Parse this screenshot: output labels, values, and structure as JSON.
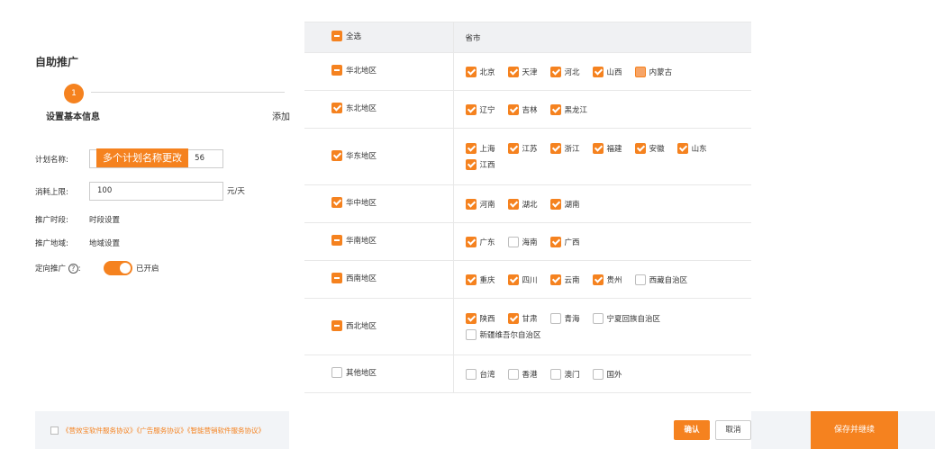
{
  "form": {
    "title": "自助推广",
    "step_number": "1",
    "step1_label": "设置基本信息",
    "step2_label": "添加",
    "plan_name_label": "计划名称:",
    "plan_name_tag": "多个计划名称更改",
    "plan_name_suffix": "56",
    "budget_label": "消耗上限:",
    "budget_value": "100",
    "budget_unit": "元/天",
    "time_label": "推广时段:",
    "time_value": "时段设置",
    "region_label": "推广地域:",
    "region_value": "地域设置",
    "targeting_label": "定向推广",
    "targeting_colon": ":",
    "help_glyph": "?",
    "targeting_state": "已开启"
  },
  "agreement": {
    "text": "《营效宝软件服务协议》《广告服务协议》《智能营销软件服务协议》"
  },
  "save_continue": "保存并继续",
  "table": {
    "select_all": "全选",
    "province_header": "省市",
    "rows": [
      {
        "region": "华北地区",
        "state": "partial",
        "provinces": [
          {
            "name": "北京",
            "state": "checked"
          },
          {
            "name": "天津",
            "state": "checked"
          },
          {
            "name": "河北",
            "state": "checked"
          },
          {
            "name": "山西",
            "state": "checked"
          },
          {
            "name": "内蒙古",
            "state": "halfone"
          }
        ]
      },
      {
        "region": "东北地区",
        "state": "checked",
        "provinces": [
          {
            "name": "辽宁",
            "state": "checked"
          },
          {
            "name": "吉林",
            "state": "checked"
          },
          {
            "name": "黑龙江",
            "state": "checked"
          }
        ]
      },
      {
        "region": "华东地区",
        "state": "checked",
        "provinces": [
          {
            "name": "上海",
            "state": "checked"
          },
          {
            "name": "江苏",
            "state": "checked"
          },
          {
            "name": "浙江",
            "state": "checked"
          },
          {
            "name": "福建",
            "state": "checked"
          },
          {
            "name": "安徽",
            "state": "checked"
          },
          {
            "name": "山东",
            "state": "checked"
          },
          {
            "name": "江西",
            "state": "checked"
          }
        ]
      },
      {
        "region": "华中地区",
        "state": "checked",
        "provinces": [
          {
            "name": "河南",
            "state": "checked"
          },
          {
            "name": "湖北",
            "state": "checked"
          },
          {
            "name": "湖南",
            "state": "checked"
          }
        ]
      },
      {
        "region": "华南地区",
        "state": "partial",
        "provinces": [
          {
            "name": "广东",
            "state": "checked"
          },
          {
            "name": "海南",
            "state": "unchecked"
          },
          {
            "name": "广西",
            "state": "checked"
          }
        ]
      },
      {
        "region": "西南地区",
        "state": "partial",
        "provinces": [
          {
            "name": "重庆",
            "state": "checked"
          },
          {
            "name": "四川",
            "state": "checked"
          },
          {
            "name": "云南",
            "state": "checked"
          },
          {
            "name": "贵州",
            "state": "checked"
          },
          {
            "name": "西藏自治区",
            "state": "unchecked"
          }
        ]
      },
      {
        "region": "西北地区",
        "state": "partial",
        "provinces": [
          {
            "name": "陕西",
            "state": "checked"
          },
          {
            "name": "甘肃",
            "state": "checked"
          },
          {
            "name": "青海",
            "state": "unchecked"
          },
          {
            "name": "宁夏回族自治区",
            "state": "unchecked"
          },
          {
            "name": "新疆维吾尔自治区",
            "state": "unchecked"
          }
        ]
      },
      {
        "region": "其他地区",
        "state": "unchecked",
        "provinces": [
          {
            "name": "台湾",
            "state": "unchecked"
          },
          {
            "name": "香港",
            "state": "unchecked"
          },
          {
            "name": "澳门",
            "state": "unchecked"
          },
          {
            "name": "国外",
            "state": "unchecked"
          }
        ]
      }
    ]
  },
  "dialog": {
    "confirm": "确认",
    "cancel": "取消"
  },
  "colors": {
    "accent": "#f5821f",
    "header_bg": "#f0f1f3",
    "bar_bg": "#f2f4f7"
  }
}
